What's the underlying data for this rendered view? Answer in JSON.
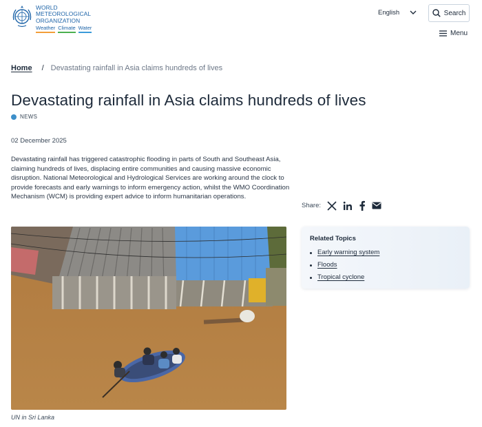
{
  "header": {
    "logo_lines": [
      "WORLD",
      "METEOROLOGICAL",
      "ORGANIZATION"
    ],
    "logo_tags": [
      "Weather",
      "Climate",
      "Water"
    ],
    "language": "English",
    "search_label": "Search",
    "menu_label": "Menu"
  },
  "breadcrumb": {
    "home": "Home",
    "separator": "/",
    "current": "Devastating rainfall in Asia claims hundreds of lives"
  },
  "article": {
    "title": "Devastating rainfall in Asia claims hundreds of lives",
    "badge": "NEWS",
    "date": "02 December 2025",
    "lead": "Devastating rainfall has triggered catastrophic flooding in parts of South and Southeast Asia, claiming hundreds of lives, displacing entire communities and causing massive economic disruption. National Meteorological and Hydrological Services are working around the clock to provide forecasts and early warnings to inform emergency action, whilst the WMO Coordination Mechanism (WCM) is providing expert advice to inform humanitarian operations.",
    "image_caption": "UN in Sri Lanka"
  },
  "share": {
    "label": "Share:",
    "icons": [
      "x-icon",
      "linkedin-icon",
      "facebook-icon",
      "email-icon"
    ]
  },
  "related": {
    "title": "Related Topics",
    "items": [
      "Early warning system",
      "Floods",
      "Tropical cyclone"
    ]
  },
  "colors": {
    "accent": "#1e64a8",
    "badge_dot": "#3d8fc9",
    "weather": "#f29d38",
    "climate": "#4bb04f",
    "water": "#3a9ad9"
  }
}
